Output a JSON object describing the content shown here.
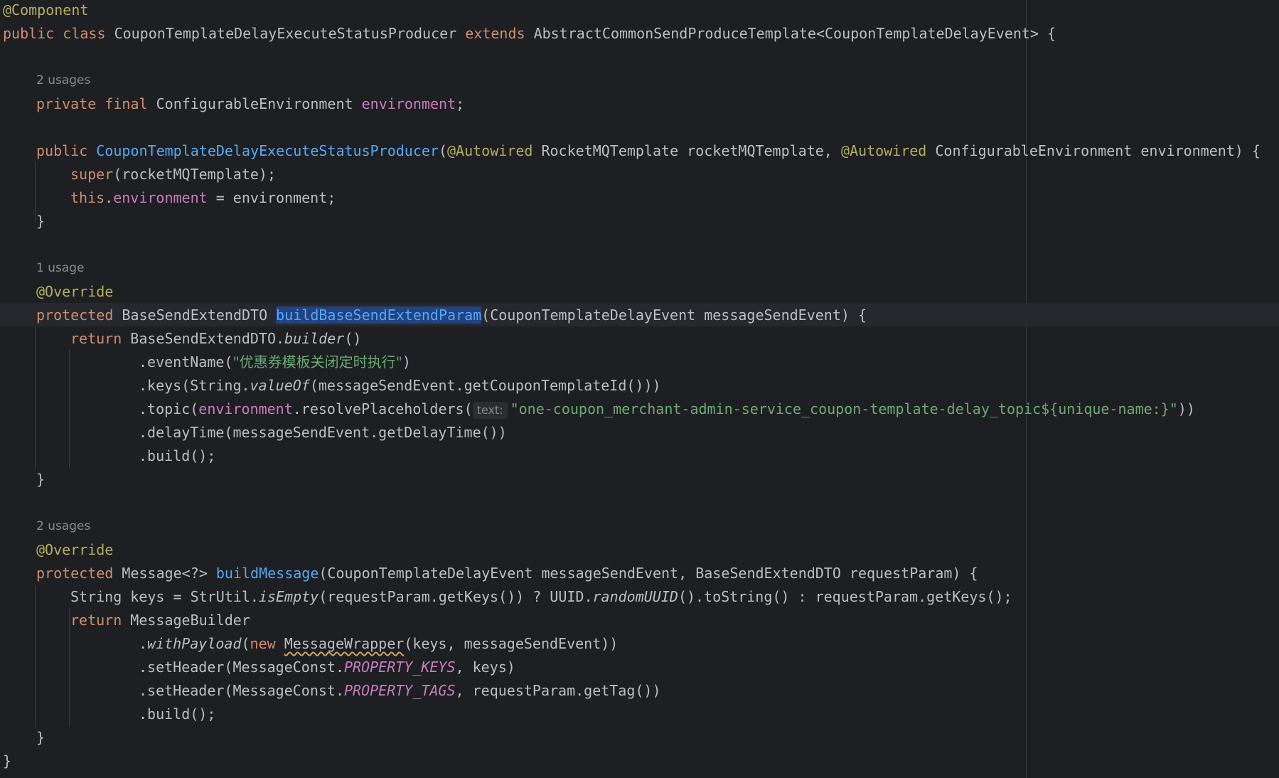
{
  "code": {
    "l1_annotation": "@Component",
    "l2_public": "public",
    "l2_class": "class",
    "l2_name": "CouponTemplateDelayExecuteStatusProducer",
    "l2_extends": "extends",
    "l2_parent": "AbstractCommonSendProduceTemplate<CouponTemplateDelayEvent> {",
    "hint_field_usages": "2 usages",
    "l3_private": "private",
    "l3_final": "final",
    "l3_type": "ConfigurableEnvironment",
    "l3_field": "environment",
    "l3_semi": ";",
    "l4_public": "public",
    "l4_ctor": "CouponTemplateDelayExecuteStatusProducer",
    "l4_open": "(",
    "l4_autowired1": "@Autowired",
    "l4_param1": "RocketMQTemplate rocketMQTemplate,",
    "l4_autowired2": "@Autowired",
    "l4_param2": "ConfigurableEnvironment environment) {",
    "l5_super": "super",
    "l5_rest": "(rocketMQTemplate);",
    "l6_this": "this",
    "l6_dot": ".",
    "l6_field": "environment",
    "l6_rest": " = environment;",
    "l7_close": "}",
    "hint_build_param_usages": "1 usage",
    "l8_override": "@Override",
    "l9_protected": "protected",
    "l9_type": "BaseSendExtendDTO",
    "l9_method": "buildBaseSendExtendParam",
    "l9_params": "(CouponTemplateDelayEvent messageSendEvent) {",
    "l10_return": "return",
    "l10_class": "BaseSendExtendDTO.",
    "l10_builder": "builder",
    "l10_parens": "()",
    "l11_method": ".eventName(",
    "l11_string": "\"优惠券模板关闭定时执行\"",
    "l11_close": ")",
    "l12_a": ".keys(String.",
    "l12_valueof": "valueOf",
    "l12_b": "(messageSendEvent.getCouponTemplateId()))",
    "l13_a": ".topic(",
    "l13_field": "environment",
    "l13_b": ".resolvePlaceholders(",
    "l13_inlay": "text:",
    "l13_string": "\"one-coupon_merchant-admin-service_coupon-template-delay_topic${unique-name:}\"",
    "l13_close": "))",
    "l14": ".delayTime(messageSendEvent.getDelayTime())",
    "l15": ".build();",
    "l16_close": "}",
    "hint_build_message_usages": "2 usages",
    "l17_override": "@Override",
    "l18_protected": "protected",
    "l18_type": "Message<?>",
    "l18_method": "buildMessage",
    "l18_params": "(CouponTemplateDelayEvent messageSendEvent, BaseSendExtendDTO requestParam) {",
    "l19_a": "String keys = StrUtil.",
    "l19_isempty": "isEmpty",
    "l19_b": "(requestParam.getKeys()) ? UUID.",
    "l19_random": "randomUUID",
    "l19_c": "().toString() : requestParam.getKeys();",
    "l20_return": "return",
    "l20_class": "MessageBuilder",
    "l21_dot": ".",
    "l21_withpayload": "withPayload",
    "l21_open": "(",
    "l21_new": "new",
    "l21_wrapper": "MessageWrapper",
    "l21_args": "(keys, messageSendEvent))",
    "l22_a": ".setHeader(MessageConst.",
    "l22_const": "PROPERTY_KEYS",
    "l22_b": ", keys)",
    "l23_a": ".setHeader(MessageConst.",
    "l23_const": "PROPERTY_TAGS",
    "l23_b": ", requestParam.getTag())",
    "l24": ".build();",
    "l25_close": "}",
    "l26_close": "}"
  },
  "colors": {
    "background": "#1e1f22",
    "text": "#bcbec4",
    "keyword": "#cf8e6d",
    "annotation": "#b3ae60",
    "field": "#c77dbb",
    "method_declaration": "#56a8f5",
    "string": "#6aab73",
    "hint": "#868a91",
    "usage_highlight": "#214283"
  }
}
